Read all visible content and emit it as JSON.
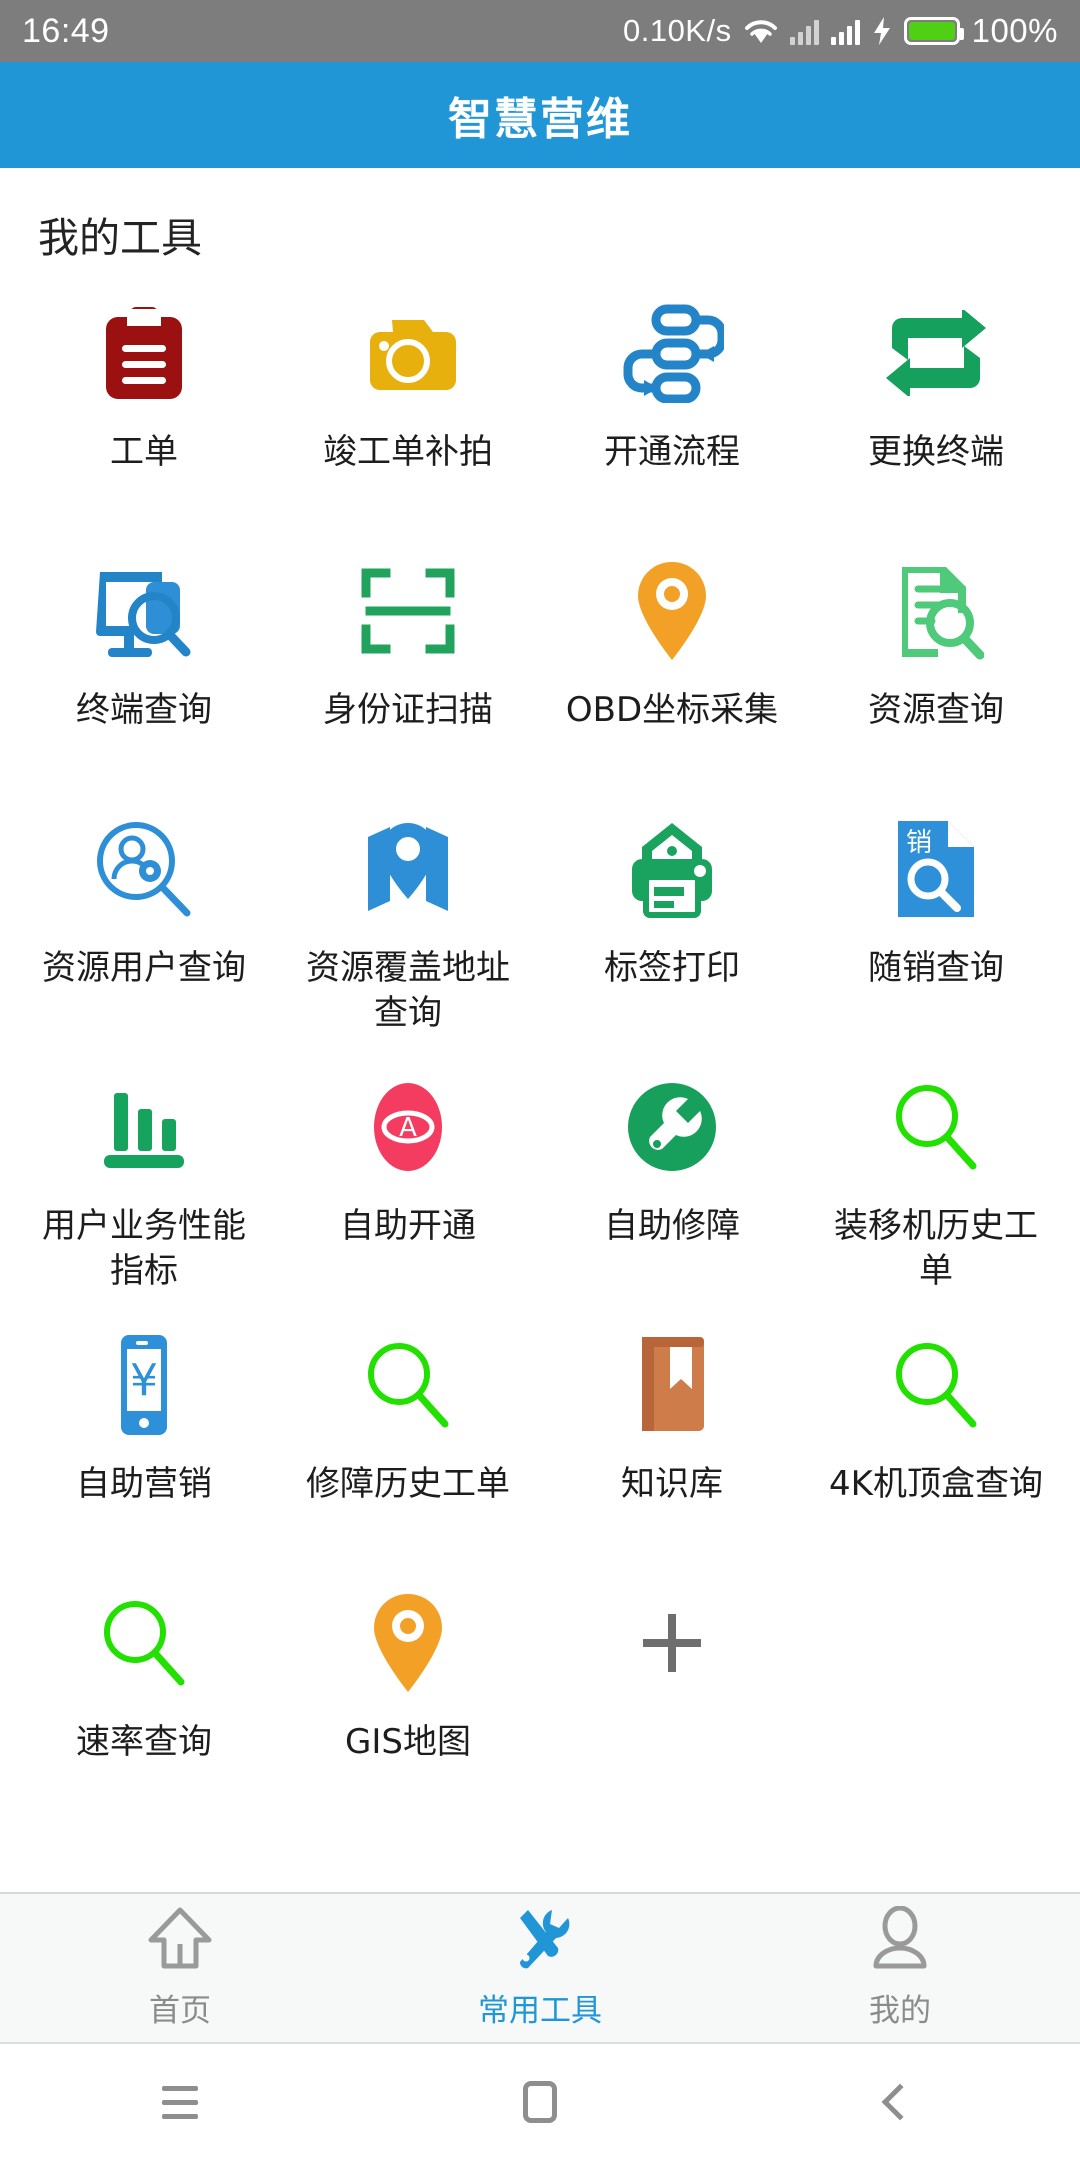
{
  "status_bar": {
    "time": "16:49",
    "net_speed": "0.10K/s",
    "wifi_icon": "wifi-icon",
    "signal_icon_1": "signal-bars-icon",
    "signal_icon_2": "signal-bars-icon",
    "charging_icon": "bolt-icon",
    "battery_icon": "battery-icon",
    "battery_percent": "100%",
    "background": "#7d7d7d"
  },
  "header": {
    "title": "智慧营维",
    "background": "#2196d6",
    "text_color": "#ffffff"
  },
  "main": {
    "section_title": "我的工具",
    "tools": [
      {
        "label": "工单",
        "icon": "clipboard-icon",
        "color": "#9b1111"
      },
      {
        "label": "竣工单补拍",
        "icon": "camera-icon",
        "color": "#e8b00c"
      },
      {
        "label": "开通流程",
        "icon": "workflow-icon",
        "color": "#2484c8"
      },
      {
        "label": "更换终端",
        "icon": "swap-repeat-icon",
        "color": "#15a05e"
      },
      {
        "label": "终端查询",
        "icon": "monitor-search-icon",
        "color": "#2484c8"
      },
      {
        "label": "身份证扫描",
        "icon": "scan-frame-icon",
        "color": "#21a35d"
      },
      {
        "label": "OBD坐标采集",
        "icon": "map-pin-icon",
        "color": "#f2a126"
      },
      {
        "label": "资源查询",
        "icon": "document-search-icon",
        "color": "#4fc97a"
      },
      {
        "label": "资源用户查询",
        "icon": "user-search-icon",
        "color": "#2e8fd6"
      },
      {
        "label": "资源覆盖地址查询",
        "icon": "map-location-icon",
        "color": "#2e8fd6"
      },
      {
        "label": "标签打印",
        "icon": "label-printer-icon",
        "color": "#1aa35e"
      },
      {
        "label": "随销查询",
        "icon": "sales-document-search-icon",
        "color": "#2e90d8"
      },
      {
        "label": "用户业务性能指标",
        "icon": "bar-chart-icon",
        "color": "#15a35e"
      },
      {
        "label": "自助开通",
        "icon": "auto-activate-icon",
        "color": "#f43b60"
      },
      {
        "label": "自助修障",
        "icon": "wrench-circle-icon",
        "color": "#16a05c"
      },
      {
        "label": "装移机历史工单",
        "icon": "magnifier-icon",
        "color": "#22e000"
      },
      {
        "label": "自助营销",
        "icon": "phone-yuan-icon",
        "color": "#2e90d8"
      },
      {
        "label": "修障历史工单",
        "icon": "magnifier-icon",
        "color": "#22e000"
      },
      {
        "label": "知识库",
        "icon": "book-icon",
        "color": "#cd7c4a"
      },
      {
        "label": "4K机顶盒查询",
        "icon": "magnifier-icon",
        "color": "#22e000"
      },
      {
        "label": "速率查询",
        "icon": "magnifier-icon",
        "color": "#22e000"
      },
      {
        "label": "GIS地图",
        "icon": "map-pin-icon",
        "color": "#f2a126"
      }
    ],
    "add_button": {
      "label": "",
      "icon": "plus-icon",
      "color": "#6e6e6e"
    }
  },
  "tab_bar": {
    "active_color": "#2196d6",
    "inactive_color": "#8b8b8b",
    "tabs": [
      {
        "label": "首页",
        "icon": "home-arrow-icon",
        "active": false
      },
      {
        "label": "常用工具",
        "icon": "tools-icon",
        "active": true
      },
      {
        "label": "我的",
        "icon": "person-icon",
        "active": false
      }
    ]
  },
  "nav_bar": {
    "recents_icon": "menu-icon",
    "home_icon": "home-square-icon",
    "back_icon": "back-chevron-icon"
  }
}
